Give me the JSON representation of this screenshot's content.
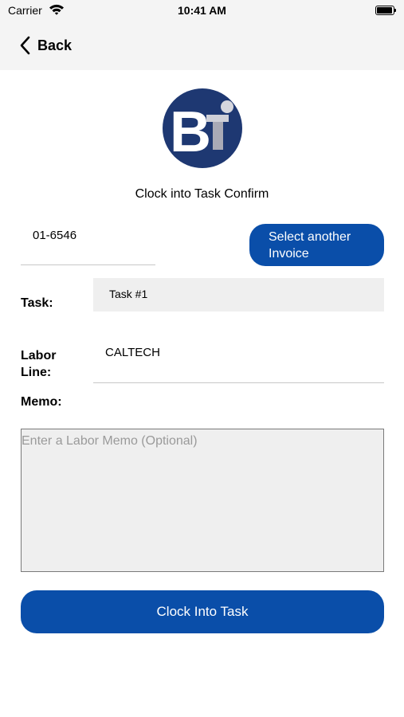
{
  "status_bar": {
    "carrier": "Carrier",
    "time": "10:41 AM"
  },
  "nav": {
    "back_label": "Back"
  },
  "logo": {
    "text": "BT"
  },
  "page_title": "Clock into Task Confirm",
  "invoice": {
    "number": "01-6546",
    "select_button_label": "Select another Invoice"
  },
  "task": {
    "label": "Task:",
    "value": "Task #1"
  },
  "labor_line": {
    "label": "Labor Line:",
    "value": "CALTECH"
  },
  "memo": {
    "label": "Memo:",
    "placeholder": "Enter a Labor Memo (Optional)"
  },
  "primary_action": {
    "label": "Clock Into Task"
  },
  "colors": {
    "accent": "#0a4ea9",
    "logo_navy": "#1e3872",
    "field_bg": "#efefef",
    "bar_bg": "#f4f4f4"
  },
  "icons": {
    "back": "chevron-left-icon",
    "wifi": "wifi-icon",
    "battery": "battery-icon"
  }
}
